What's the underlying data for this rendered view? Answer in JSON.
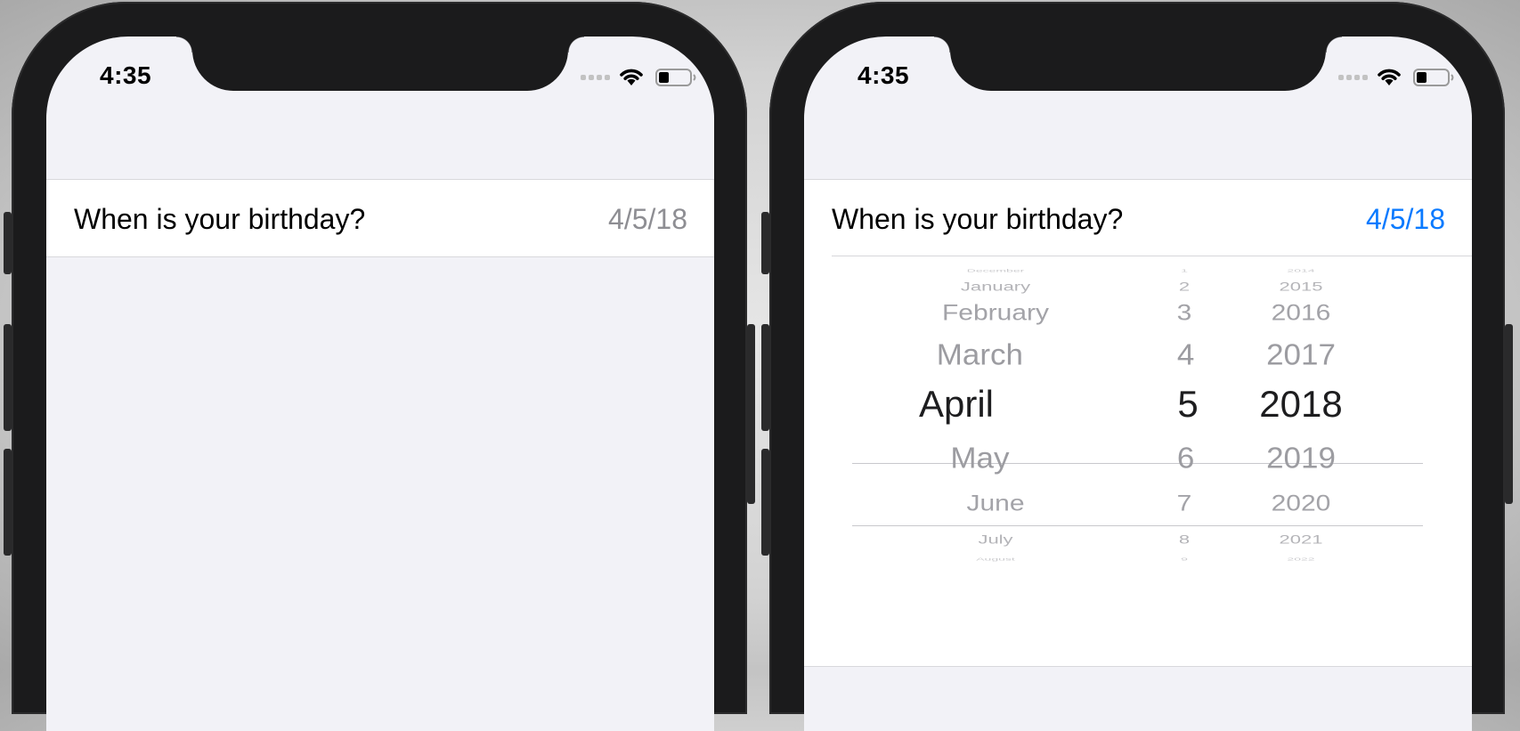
{
  "screens": [
    {
      "status_bar": {
        "time": "4:35"
      },
      "form_row": {
        "label": "When is your birthday?",
        "value": "4/5/18"
      }
    },
    {
      "status_bar": {
        "time": "4:35"
      },
      "form_row": {
        "label": "When is your birthday?",
        "value": "4/5/18",
        "value_color": "#0a7aff"
      },
      "date_picker": {
        "months": [
          "December",
          "January",
          "February",
          "March",
          "April",
          "May",
          "June",
          "July",
          "August"
        ],
        "days": [
          "1",
          "2",
          "3",
          "4",
          "5",
          "6",
          "7",
          "8",
          "9"
        ],
        "years": [
          "2014",
          "2015",
          "2016",
          "2017",
          "2018",
          "2019",
          "2020",
          "2021",
          "2022"
        ],
        "selected": {
          "month": "April",
          "day": "5",
          "year": "2018"
        }
      }
    }
  ],
  "colors": {
    "accent": "#0a7aff",
    "screen_background": "#f2f2f7",
    "cell_background": "#ffffff",
    "secondary_text": "#8e8e93",
    "device_frame": "#1b1b1c"
  }
}
